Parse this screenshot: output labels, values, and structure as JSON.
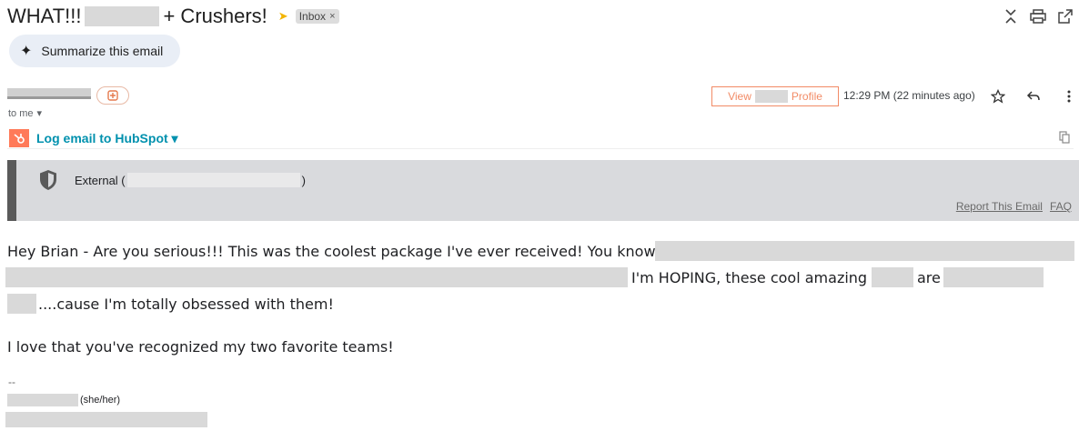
{
  "subject": {
    "prefix": "WHAT!!!",
    "suffix": "+ Crushers!",
    "label": "Inbox",
    "label_close": "×"
  },
  "toolbar_icons": [
    "collapse-icon",
    "print-icon",
    "open-in-new-window-icon"
  ],
  "summarize": {
    "label": "Summarize this email"
  },
  "sender": {
    "to_label": "to me",
    "view_profile_prefix": "View",
    "view_profile_suffix": "Profile",
    "time": "12:29 PM (22 minutes ago)"
  },
  "hubspot": {
    "label": "Log email to HubSpot"
  },
  "external": {
    "prefix": "External (",
    "suffix": ")",
    "report_link": "Report This Email",
    "faq_link": "FAQ"
  },
  "body": {
    "line1": "Hey Brian - Are you serious!!! This was the coolest package I've ever received! You know",
    "line2": "I'm HOPING, these cool amazing",
    "line2b": "are",
    "line3": "....cause I'm totally obsessed with them!",
    "line4": "I love that you've recognized my two favorite teams!"
  },
  "signature": {
    "dash": "--",
    "pronouns": "(she/her)"
  },
  "colors": {
    "hubspot_orange": "#ff7a59",
    "hubspot_teal": "#0091ae",
    "banner_gray": "#d9dadd",
    "profile_orange": "#f28b66"
  }
}
